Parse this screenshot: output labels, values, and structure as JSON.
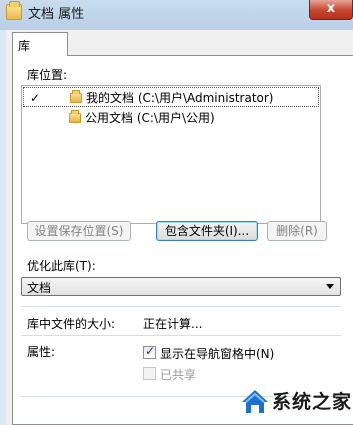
{
  "window": {
    "title": "文档 属性",
    "close_label": "x"
  },
  "tabs": [
    {
      "label": "库"
    }
  ],
  "library": {
    "locations_label": "库位置:",
    "locations": [
      {
        "label": "我的文档 (C:\\用户\\Administrator)",
        "checked": true,
        "selected": true
      },
      {
        "label": "公用文档 (C:\\用户\\公用)",
        "checked": false,
        "selected": false
      }
    ],
    "buttons": {
      "set_save_location": "设置保存位置(S)",
      "include_folder": "包含文件夹(I)...",
      "remove": "删除(R)"
    },
    "optimize_label": "优化此库(T):",
    "optimize_value": "文档",
    "size_label": "库中文件的大小:",
    "size_value": "正在计算...",
    "attributes_label": "属性:",
    "show_in_nav_label": "显示在导航窗格中(N)",
    "show_in_nav_checked": true,
    "shared_label": "已共享",
    "shared_checked": false
  },
  "watermark": {
    "text": "系统之家"
  },
  "colors": {
    "titlebar": "#c9dcee",
    "close": "#c7442d",
    "panel": "#ffffff",
    "frame": "#f0f0f0"
  }
}
